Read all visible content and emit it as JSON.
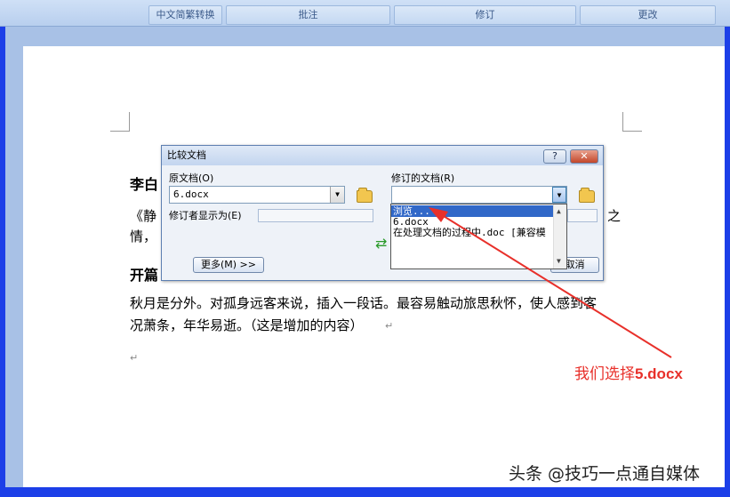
{
  "ribbon": {
    "groups": [
      "中文简繁转换",
      "批注",
      "修订",
      "更改"
    ]
  },
  "document": {
    "title_line": "李白",
    "line1": "《静",
    "line1_right": "之",
    "line2": "情，",
    "heading2": "开篇",
    "para1": "秋月是分外。对孤身远客来说，插入一段话。最容易触动旅思秋怀，使人感到客",
    "para2": "况萧条，年华易逝。（这是增加的内容）",
    "return_mark": "↵"
  },
  "dialog": {
    "title": "比较文档",
    "help_label": "?",
    "close_label": "✕",
    "original_label": "原文档(O)",
    "original_value": "6.docx",
    "author_label": "修订者显示为(E)",
    "revised_label": "修订的文档(R)",
    "revised_value": "",
    "more_button": "更多(M) >>",
    "cancel_partial": "取消"
  },
  "dropdown": {
    "options": [
      "浏览...",
      "6.docx",
      "在处理文档的过程中.doc [兼容模"
    ],
    "selected_index": 0
  },
  "annotation": {
    "prefix": "我们选择",
    "emphasis": "5.docx",
    "color": "#e8302a"
  },
  "watermark": "头条 @技巧一点通自媒体"
}
